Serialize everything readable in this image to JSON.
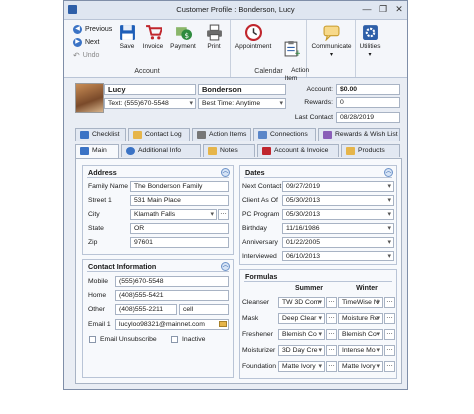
{
  "window": {
    "title": "Customer Profile : Bonderson, Lucy",
    "minimize": "—",
    "restore": "❐",
    "close": "✕"
  },
  "ribbon": {
    "nav": {
      "previous": "Previous",
      "next": "Next",
      "undo": "Undo"
    },
    "buttons": {
      "save": "Save",
      "invoice": "Invoice",
      "payment": "Payment",
      "print": "Print",
      "appointment": "Appointment",
      "action_item": "Action\nItem",
      "communicate": "Communicate",
      "utilities": "Utilities"
    },
    "groups": {
      "account": "Account",
      "calendar": "Calendar"
    }
  },
  "profile": {
    "first_name": "Lucy",
    "last_name": "Bonderson",
    "text_phone": "Text: (555)670-5548",
    "best_time": "Best Time: Anytime",
    "account_label": "Account:",
    "account_value": "$0.00",
    "rewards_label": "Rewards:",
    "rewards_value": "0",
    "last_contact_label": "Last Contact",
    "last_contact_value": "08/28/2019"
  },
  "tabs_row1": [
    "Checklist",
    "Contact Log",
    "Action Items",
    "Connections",
    "Rewards & Wish List"
  ],
  "tabs_row2": [
    "Main",
    "Additional Info",
    "Notes",
    "Account & Invoice",
    "Products"
  ],
  "address": {
    "title": "Address",
    "family_name_label": "Family Name",
    "family_name": "The Bonderson Family",
    "street_label": "Street 1",
    "street": "531 Main Place",
    "city_label": "City",
    "city": "Klamath Falls",
    "state_label": "State",
    "state": "OR",
    "zip_label": "Zip",
    "zip": "97601"
  },
  "contact": {
    "title": "Contact Information",
    "mobile_label": "Mobile",
    "mobile": "(555)670-5548",
    "home_label": "Home",
    "home": "(408)555-5421",
    "other_label": "Other",
    "other": "(408)555-2211",
    "other_type": "cell",
    "email_label": "Email 1",
    "email": "lucyloo98321@mainnet.com",
    "unsubscribe_label": "Email Unsubscribe",
    "inactive_label": "Inactive"
  },
  "dates": {
    "title": "Dates",
    "items": [
      {
        "label": "Next Contact",
        "value": "09/27/2019"
      },
      {
        "label": "Client As Of",
        "value": "05/30/2013"
      },
      {
        "label": "PC Program",
        "value": "05/30/2013"
      },
      {
        "label": "Birthday",
        "value": "11/16/1986"
      },
      {
        "label": "Anniversary",
        "value": "01/22/2005"
      },
      {
        "label": "Interviewed",
        "value": "06/10/2013"
      }
    ]
  },
  "formulas": {
    "title": "Formulas",
    "summer_header": "Summer",
    "winter_header": "Winter",
    "rows": [
      {
        "label": "Cleanser",
        "summer": "TW 3D Com",
        "winter": "TimeWise N"
      },
      {
        "label": "Mask",
        "summer": "Deep Clear",
        "winter": "Moisture Re"
      },
      {
        "label": "Freshener",
        "summer": "Blemish Co",
        "winter": "Blemish Co"
      },
      {
        "label": "Moisturizer",
        "summer": "3D Day Cre",
        "winter": "Intense Mo"
      },
      {
        "label": "Foundation",
        "summer": "Matte Ivory",
        "winter": "Matte Ivory"
      }
    ]
  },
  "colors": {
    "accent": "#3b73c5",
    "panel_bg": "#f7f9fc",
    "window_bg": "#e9edf4"
  }
}
